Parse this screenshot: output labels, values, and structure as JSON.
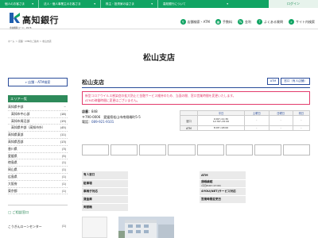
{
  "topnav": {
    "items": [
      "個人のお客さま",
      "法人・個人事業主のお客さま",
      "株主・投資家の皆さま",
      "高知銀行について"
    ],
    "login_label": "ログイン"
  },
  "header": {
    "bank_name": "高知銀行",
    "bank_code": "金融機関コード：0578",
    "nav": [
      {
        "icon": "pin-icon",
        "label": "店舗検索・ATM"
      },
      {
        "icon": "calculator-icon",
        "label": "手数料"
      },
      {
        "icon": "percent-icon",
        "label": "金利"
      },
      {
        "icon": "question-icon",
        "label": "よくある質問"
      },
      {
        "icon": "sitemap-icon",
        "label": "サイト内検索"
      }
    ]
  },
  "breadcrumb": [
    "ホーム",
    "店舗・ATMのご案内",
    "松山支店"
  ],
  "page_title": "松山支店",
  "sidebar": {
    "search_button": "店舗・ATM検索",
    "area_heading": "エリア一覧",
    "areas": [
      {
        "label": "高知県中部",
        "count": "(16)",
        "sub": false,
        "toggle": "−"
      },
      {
        "label": "高知市中心部",
        "count": "(18)",
        "sub": true
      },
      {
        "label": "高知市周辺部",
        "count": "(19)",
        "sub": true
      },
      {
        "label": "高知県中部（高知市外）",
        "count": "(45)",
        "sub": true
      },
      {
        "label": "高知県東部",
        "count": "(11)",
        "sub": false
      },
      {
        "label": "高知県西部",
        "count": "(13)",
        "sub": false
      },
      {
        "label": "香川県",
        "count": "(3)",
        "sub": false
      },
      {
        "label": "愛媛県",
        "count": "(5)",
        "sub": false
      },
      {
        "label": "徳島県",
        "count": "(1)",
        "sub": false
      },
      {
        "label": "岡山県",
        "count": "(1)",
        "sub": false
      },
      {
        "label": "広島県",
        "count": "(1)",
        "sub": false
      },
      {
        "label": "大阪府",
        "count": "(1)",
        "sub": false
      },
      {
        "label": "東京都",
        "count": "(1)",
        "sub": false
      }
    ],
    "consult_heading": "ご相談窓口",
    "consult_item": {
      "label": "こうぎんローンセンター",
      "count": "(1)"
    }
  },
  "main": {
    "branch_name": "松山支店",
    "tags": [
      "ATM",
      "窓口（有人店舗）"
    ],
    "notice": [
      "新型コロナウイルス感染症の拡大防止と金融サービス維持のため、当面の間、窓口営業時間を変更いたします。",
      "ATMの稼働時間に変更はございません。"
    ],
    "store_no_label": "店番：",
    "store_no": "848",
    "address": "〒790-0006　愛媛県松山市南堀端町5-5",
    "tel_label": "電話：",
    "tel": "089-921-9101",
    "hours": {
      "headers": [
        "",
        "平日",
        "土曜日",
        "日曜日",
        "祝日"
      ],
      "rows": [
        {
          "label": "窓口",
          "weekday": [
            "9:00～11:30",
            "12:30～15:00"
          ],
          "sat": "-",
          "sun": "-",
          "hol": "-"
        },
        {
          "label": "ATM",
          "weekday": [
            "8:45～18:00"
          ],
          "sat": "-",
          "sun": "-",
          "hol": "-"
        }
      ]
    },
    "services_count": 8,
    "attrs_left": [
      "有人窓口",
      "駐車場",
      "車椅子対応",
      "貸金庫",
      "両替機"
    ],
    "attrs_right": [
      "ATM",
      "通帳繰越",
      "(平日8:00～17:00)",
      "4YOU(NET)サービス対応",
      "営業時間変更日"
    ]
  },
  "colors": {
    "brand_green": "#11a463",
    "navy": "#2a4c9a",
    "notice_red": "#e23b6c"
  }
}
